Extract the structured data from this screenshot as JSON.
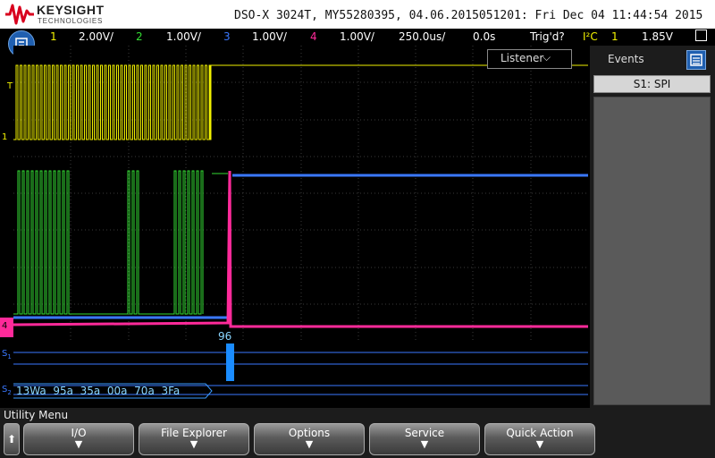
{
  "brand": {
    "name": "KEYSIGHT",
    "sub": "TECHNOLOGIES"
  },
  "title": "DSO-X 3024T, MY55280395, 04.06.2015051201: Fri Dec 04 11:44:54 2015",
  "channels": [
    {
      "num": "1",
      "scale": "2.00V/",
      "color": "#f0f000"
    },
    {
      "num": "2",
      "scale": "1.00V/",
      "color": "#33dd33"
    },
    {
      "num": "3",
      "scale": "1.00V/",
      "color": "#3a78ff"
    },
    {
      "num": "4",
      "scale": "1.00V/",
      "color": "#ff2a9a"
    }
  ],
  "timebase": "250.0us/",
  "delay": "0.0s",
  "trigger": {
    "status": "Trig'd?",
    "source_label": "I²C",
    "source_channel": "1",
    "level": "1.85V"
  },
  "listener": {
    "label": "Listener",
    "chevron": "⌵"
  },
  "events": {
    "title": "Events",
    "tab": "S1: SPI"
  },
  "markers": {
    "trigger_T": "T",
    "ch1": "1",
    "s1": "S",
    "s1_sub": "1",
    "s2": "S",
    "s2_sub": "2",
    "ch4": "4"
  },
  "decode": {
    "s1_value": "96",
    "s2_values": [
      "13Wa",
      "95a",
      "35a",
      "00a",
      "70a",
      "3Fa"
    ]
  },
  "softkeys": {
    "menu_label": "Utility Menu",
    "back": "⬆",
    "keys": [
      {
        "label": "I/O",
        "arrow": "▼"
      },
      {
        "label": "File Explorer",
        "arrow": "▼"
      },
      {
        "label": "Options",
        "arrow": "▼"
      },
      {
        "label": "Service",
        "arrow": "▼"
      },
      {
        "label": "Quick Action",
        "arrow": "▼"
      }
    ]
  },
  "colors": {
    "ch1": "#f0f000",
    "ch2": "#33dd33",
    "ch3": "#3a78ff",
    "ch4": "#ff2a9a",
    "decode": "#8ad6ff",
    "accent": "#1f5fb0"
  },
  "icons": {
    "menu": "scope-menu-icon",
    "events": "events-list-icon",
    "logo": "keysight-wave-icon"
  }
}
